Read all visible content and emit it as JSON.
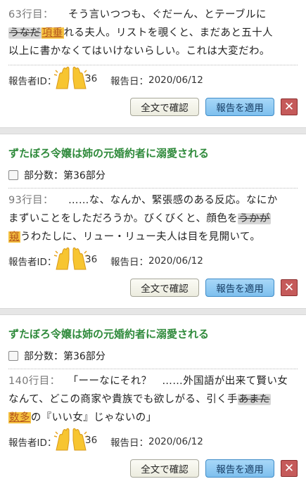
{
  "reports": [
    {
      "line_label": "63行目：",
      "text_lines": [
        {
          "segments": [
            {
              "t": "そう言いつつも、ぐだーん、とテーブルに",
              "k": "n"
            }
          ]
        },
        {
          "segments": [
            {
              "t": "うなだ",
              "k": "s"
            },
            {
              "t": "項垂",
              "k": "r"
            },
            {
              "t": "れる夫人。リストを覗くと、まだあと五十人",
              "k": "n"
            }
          ]
        },
        {
          "segments": [
            {
              "t": "以上に書かなくてはいけないらしい。これは大変だわ。",
              "k": "n"
            }
          ]
        }
      ],
      "reporter_label": "報告者ID：",
      "reporter_suffix": "36",
      "date_label": "報告日：",
      "date": "2020/06/12",
      "btn_full": "全文で確認",
      "btn_apply": "報告を適用",
      "btn_close": "✕"
    },
    {
      "work_title": "ずたぼろ令嬢は姉の元婚約者に溺愛される",
      "part_label": "部分数：第36部分",
      "line_label": "93行目：",
      "text_lines": [
        {
          "segments": [
            {
              "t": "……な、なんか、緊張感のある反応。なにか",
              "k": "n"
            }
          ]
        },
        {
          "segments": [
            {
              "t": "まずいことをしただろうか。びくびくと、顔色を",
              "k": "n"
            },
            {
              "t": "うかが",
              "k": "s"
            }
          ]
        },
        {
          "segments": [
            {
              "t": "窺",
              "k": "r"
            },
            {
              "t": "うわたしに、リュー・リュー夫人は目を見開いて。",
              "k": "n"
            }
          ]
        }
      ],
      "reporter_label": "報告者ID：",
      "reporter_suffix": "36",
      "date_label": "報告日：",
      "date": "2020/06/12",
      "btn_full": "全文で確認",
      "btn_apply": "報告を適用",
      "btn_close": "✕"
    },
    {
      "work_title": "ずたぼろ令嬢は姉の元婚約者に溺愛される",
      "part_label": "部分数：第36部分",
      "line_label": "140行目：",
      "text_lines": [
        {
          "segments": [
            {
              "t": "「ーーなにそれ？　……外国語が出来て賢い女",
              "k": "n"
            }
          ]
        },
        {
          "segments": [
            {
              "t": "なんて、どこの商家や貴族でも欲しがる、引く手",
              "k": "n"
            },
            {
              "t": "あまた",
              "k": "s"
            }
          ]
        },
        {
          "segments": [
            {
              "t": "数多",
              "k": "r"
            },
            {
              "t": "の『いい女』じゃないの」",
              "k": "n"
            }
          ]
        }
      ],
      "reporter_label": "報告者ID：",
      "reporter_suffix": "36",
      "date_label": "報告日：",
      "date": "2020/06/12",
      "btn_full": "全文で確認",
      "btn_apply": "報告を適用",
      "btn_close": "✕"
    }
  ],
  "icons": {
    "hands": "raising-hands-emoji-icon",
    "checkbox": "checkbox-icon",
    "close": "close-icon"
  },
  "colors": {
    "title_green": "#2f8a3b",
    "apply_blue": "#7ec0ee",
    "close_red": "#c55a5a",
    "replacement_highlight": "#f6c442",
    "strike_bg": "#d6d6d6"
  }
}
